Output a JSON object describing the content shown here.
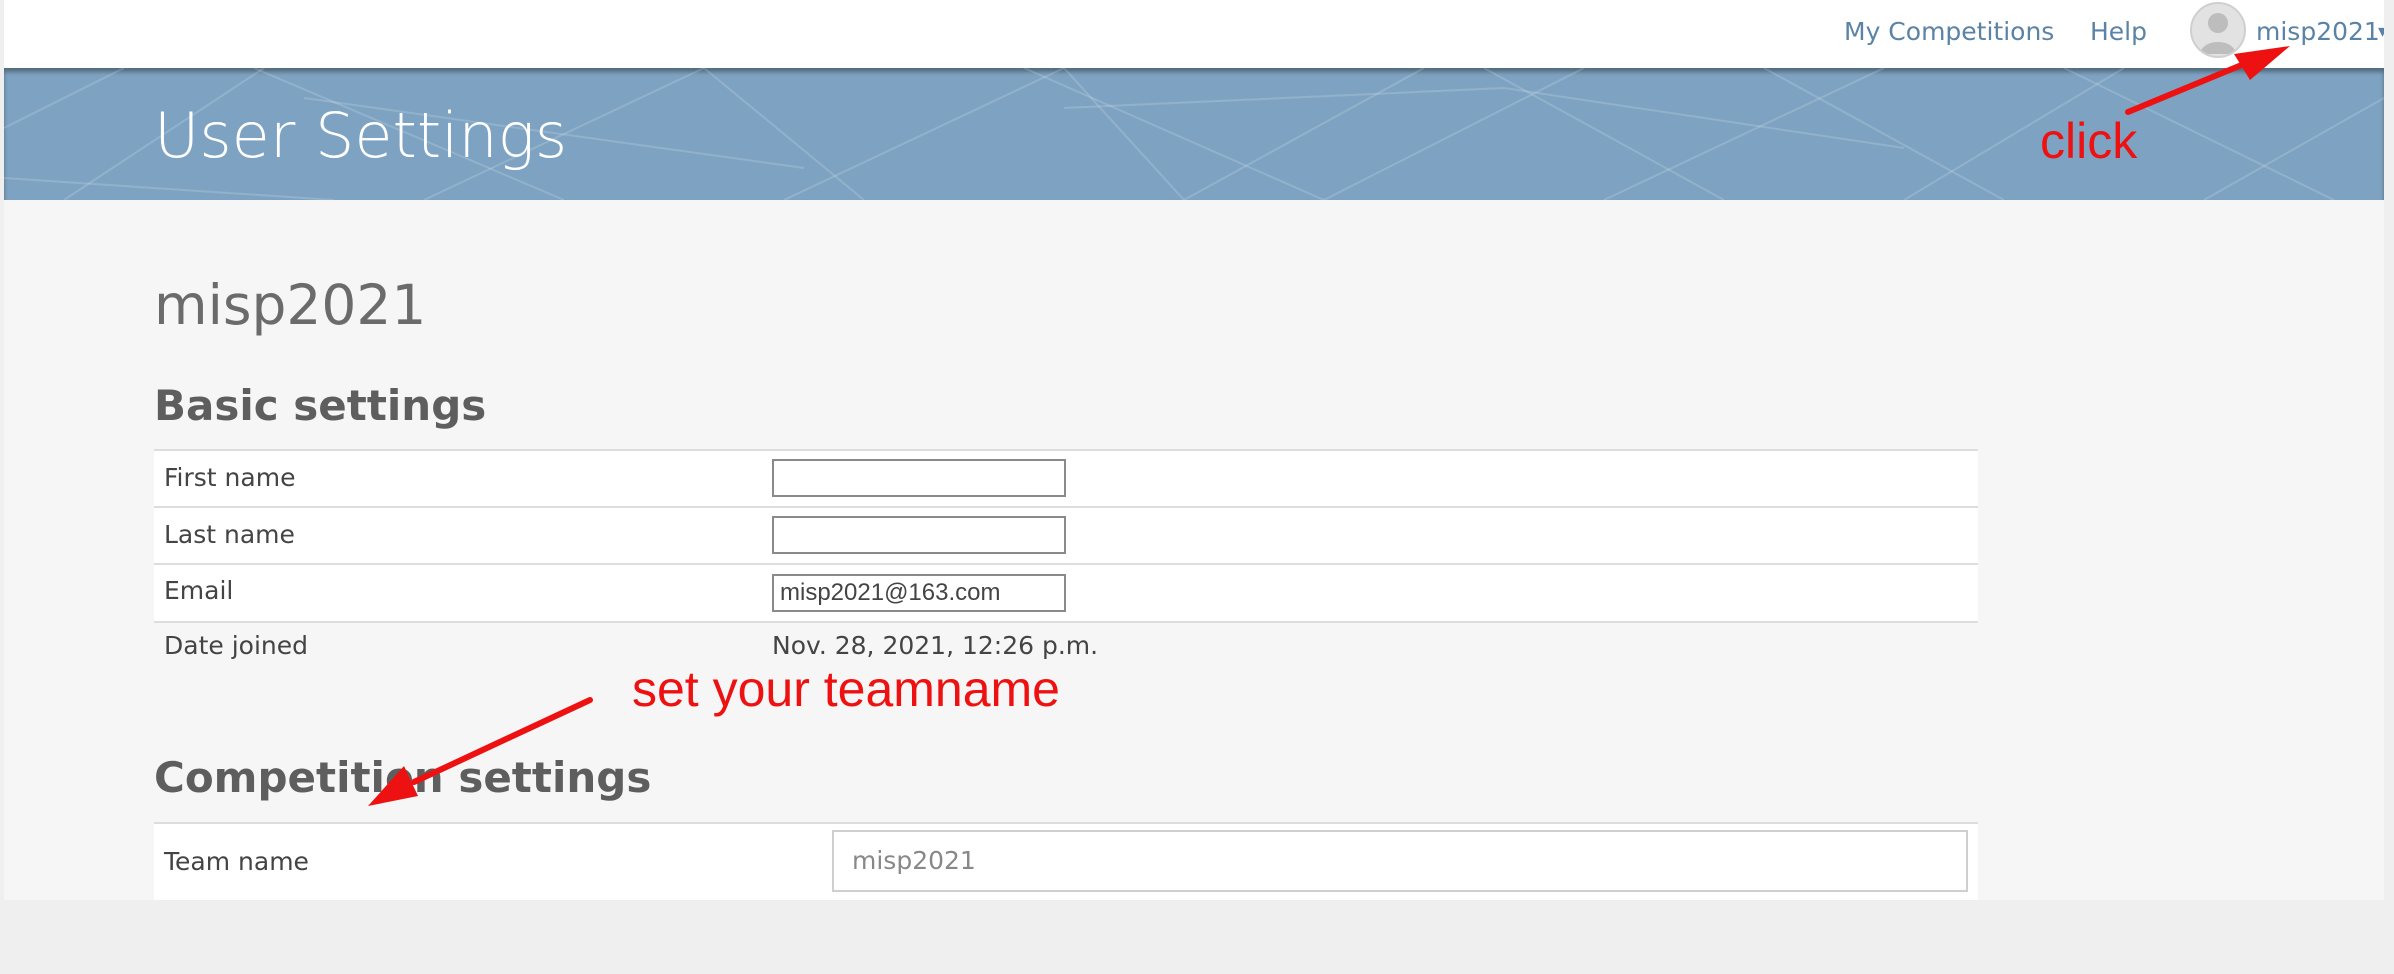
{
  "nav": {
    "my_competitions": "My Competitions",
    "help": "Help",
    "username": "misp2021",
    "caret": "▾"
  },
  "banner": {
    "title": "User Settings"
  },
  "profile": {
    "username": "misp2021"
  },
  "basic_settings": {
    "title": "Basic settings",
    "first_name": {
      "label": "First name",
      "value": ""
    },
    "last_name": {
      "label": "Last name",
      "value": ""
    },
    "email": {
      "label": "Email",
      "value": "misp2021@163.com"
    },
    "date_joined": {
      "label": "Date joined",
      "value": "Nov. 28, 2021, 12:26 p.m."
    }
  },
  "competition_settings": {
    "title": "Competition settings",
    "team_name": {
      "label": "Team name",
      "value": "misp2021"
    }
  },
  "annotations": {
    "click": "click",
    "set_teamname": "set your teamname"
  },
  "colors": {
    "banner": "#7ea3c2",
    "link": "#5b83a6",
    "annotation": "#ee1111"
  }
}
